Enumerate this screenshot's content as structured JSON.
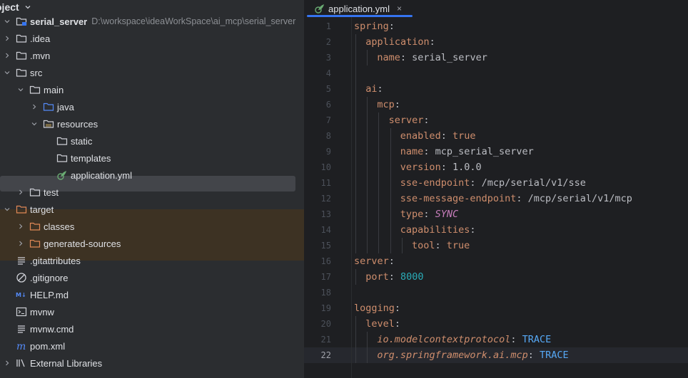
{
  "project_panel": {
    "header": "oject",
    "tree": [
      {
        "label": "serial_server",
        "path": "D:\\workspace\\ideaWorkSpace\\ai_mcp\\serial_server",
        "icon": "module-folder-icon",
        "chevron": "down",
        "depth": 0
      },
      {
        "label": ".idea",
        "icon": "folder-icon",
        "chevron": "right",
        "depth": 0
      },
      {
        "label": ".mvn",
        "icon": "folder-icon",
        "chevron": "right",
        "depth": 0
      },
      {
        "label": "src",
        "icon": "folder-icon",
        "chevron": "down",
        "depth": 0
      },
      {
        "label": "main",
        "icon": "folder-icon",
        "chevron": "down",
        "depth": 1
      },
      {
        "label": "java",
        "icon": "source-folder-icon",
        "chevron": "right",
        "depth": 2
      },
      {
        "label": "resources",
        "icon": "resources-folder-icon",
        "chevron": "down",
        "depth": 2
      },
      {
        "label": "static",
        "icon": "folder-icon",
        "chevron": "",
        "depth": 3
      },
      {
        "label": "templates",
        "icon": "folder-icon",
        "chevron": "",
        "depth": 3
      },
      {
        "label": "application.yml",
        "icon": "spring-config-icon",
        "chevron": "",
        "depth": 3,
        "selected": true
      },
      {
        "label": "test",
        "icon": "folder-icon",
        "chevron": "right",
        "depth": 1
      },
      {
        "label": "target",
        "icon": "excluded-folder-icon",
        "chevron": "down",
        "depth": 0,
        "excluded": true
      },
      {
        "label": "classes",
        "icon": "excluded-folder-icon",
        "chevron": "right",
        "depth": 1,
        "excluded": true
      },
      {
        "label": "generated-sources",
        "icon": "excluded-folder-icon",
        "chevron": "right",
        "depth": 1,
        "excluded": true
      },
      {
        "label": ".gitattributes",
        "icon": "text-file-icon",
        "chevron": "",
        "depth": 0
      },
      {
        "label": ".gitignore",
        "icon": "gitignore-icon",
        "chevron": "",
        "depth": 0
      },
      {
        "label": "HELP.md",
        "icon": "markdown-icon",
        "chevron": "",
        "depth": 0
      },
      {
        "label": "mvnw",
        "icon": "shell-file-icon",
        "chevron": "",
        "depth": 0
      },
      {
        "label": "mvnw.cmd",
        "icon": "text-file-icon",
        "chevron": "",
        "depth": 0
      },
      {
        "label": "pom.xml",
        "icon": "maven-icon",
        "chevron": "",
        "depth": 0
      },
      {
        "label": "External Libraries",
        "icon": "library-icon",
        "chevron": "right",
        "depth": 0
      }
    ]
  },
  "editor": {
    "tab": {
      "label": "application.yml",
      "close": "×"
    },
    "line_numbers": [
      "1",
      "2",
      "3",
      "4",
      "5",
      "6",
      "7",
      "8",
      "9",
      "10",
      "11",
      "12",
      "13",
      "14",
      "15",
      "16",
      "17",
      "18",
      "19",
      "20",
      "21",
      "22"
    ],
    "lines": [
      {
        "key": "spring",
        "sep": ":",
        "value": "",
        "vtype": ""
      },
      {
        "key": "application",
        "sep": ":",
        "value": "",
        "vtype": ""
      },
      {
        "key": "name",
        "sep": ": ",
        "value": "serial_server",
        "vtype": "v"
      },
      {
        "key": "",
        "sep": "",
        "value": "",
        "vtype": ""
      },
      {
        "key": "ai",
        "sep": ":",
        "value": "",
        "vtype": ""
      },
      {
        "key": "mcp",
        "sep": ":",
        "value": "",
        "vtype": ""
      },
      {
        "key": "server",
        "sep": ":",
        "value": "",
        "vtype": ""
      },
      {
        "key": "enabled",
        "sep": ": ",
        "value": "true",
        "vtype": "kw"
      },
      {
        "key": "name",
        "sep": ": ",
        "value": "mcp_serial_server",
        "vtype": "v"
      },
      {
        "key": "version",
        "sep": ": ",
        "value": "1.0.0",
        "vtype": "v"
      },
      {
        "key": "sse-endpoint",
        "sep": ": ",
        "value": "/mcp/serial/v1/sse",
        "vtype": "v"
      },
      {
        "key": "sse-message-endpoint",
        "sep": ": ",
        "value": "/mcp/serial/v1/mcp",
        "vtype": "v"
      },
      {
        "key": "type",
        "sep": ": ",
        "value": "SYNC",
        "vtype": "enum"
      },
      {
        "key": "capabilities",
        "sep": ":",
        "value": "",
        "vtype": ""
      },
      {
        "key": "tool",
        "sep": ": ",
        "value": "true",
        "vtype": "kw"
      },
      {
        "key": "server",
        "sep": ":",
        "value": "",
        "vtype": ""
      },
      {
        "key": "port",
        "sep": ": ",
        "value": "8000",
        "vtype": "num"
      },
      {
        "key": "",
        "sep": "",
        "value": "",
        "vtype": ""
      },
      {
        "key": "logging",
        "sep": ":",
        "value": "",
        "vtype": ""
      },
      {
        "key": "level",
        "sep": ":",
        "value": "",
        "vtype": ""
      },
      {
        "key": "io.modelcontextprotocol",
        "sep": ": ",
        "value": "TRACE",
        "vtype": "trace",
        "italic": true
      },
      {
        "key": "org.springframework.ai.mcp",
        "sep": ": ",
        "value": "TRACE",
        "vtype": "trace",
        "italic": true
      }
    ]
  }
}
